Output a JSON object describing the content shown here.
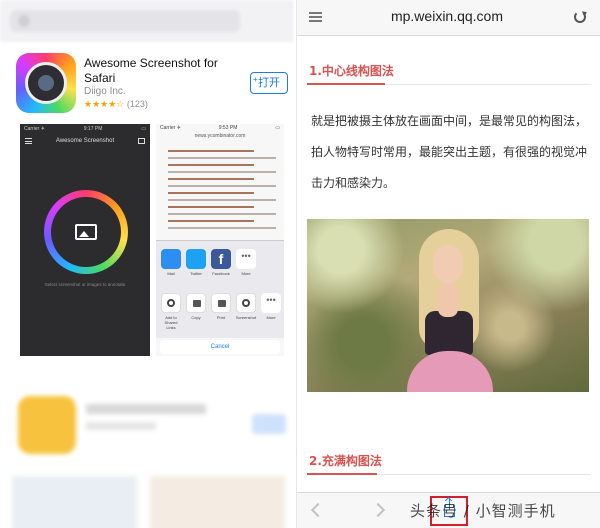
{
  "left": {
    "app": {
      "title": "Awesome Screenshot for Safari",
      "developer": "Diigo Inc.",
      "rating_stars": "★★★★☆",
      "rating_count": "(123)",
      "get_button": "打开",
      "get_button_plus": "+"
    },
    "phone1": {
      "carrier": "Carrier ✈",
      "time": "9:17 PM",
      "title": "Awesome Screenshot",
      "hint": "Select screenshot or images to annotate"
    },
    "phone2": {
      "carrier": "Carrier ✈",
      "time": "9:53 PM",
      "url": "news.ycombinator.com",
      "share_row1": [
        "Mail",
        "Twitter",
        "Facebook",
        "More"
      ],
      "share_row2": [
        "Add to Shared Links",
        "Copy",
        "Print",
        "Screenshot",
        "More"
      ],
      "cancel": "Cancel"
    }
  },
  "right": {
    "url": "mp.weixin.qq.com",
    "section1_heading": "1.中心线构图法",
    "paragraph": "就是把被摄主体放在画面中间，是最常见的构图法，拍人物特写时常用，最能突出主题，有很强的视觉冲击力和感染力。",
    "section2_heading": "2.充满构图法"
  },
  "watermark": "头条号 / 小智测手机",
  "colors": {
    "accent_red": "#d9534f",
    "highlight_box": "#d11f2c",
    "ios_blue": "#1a7cf4"
  }
}
